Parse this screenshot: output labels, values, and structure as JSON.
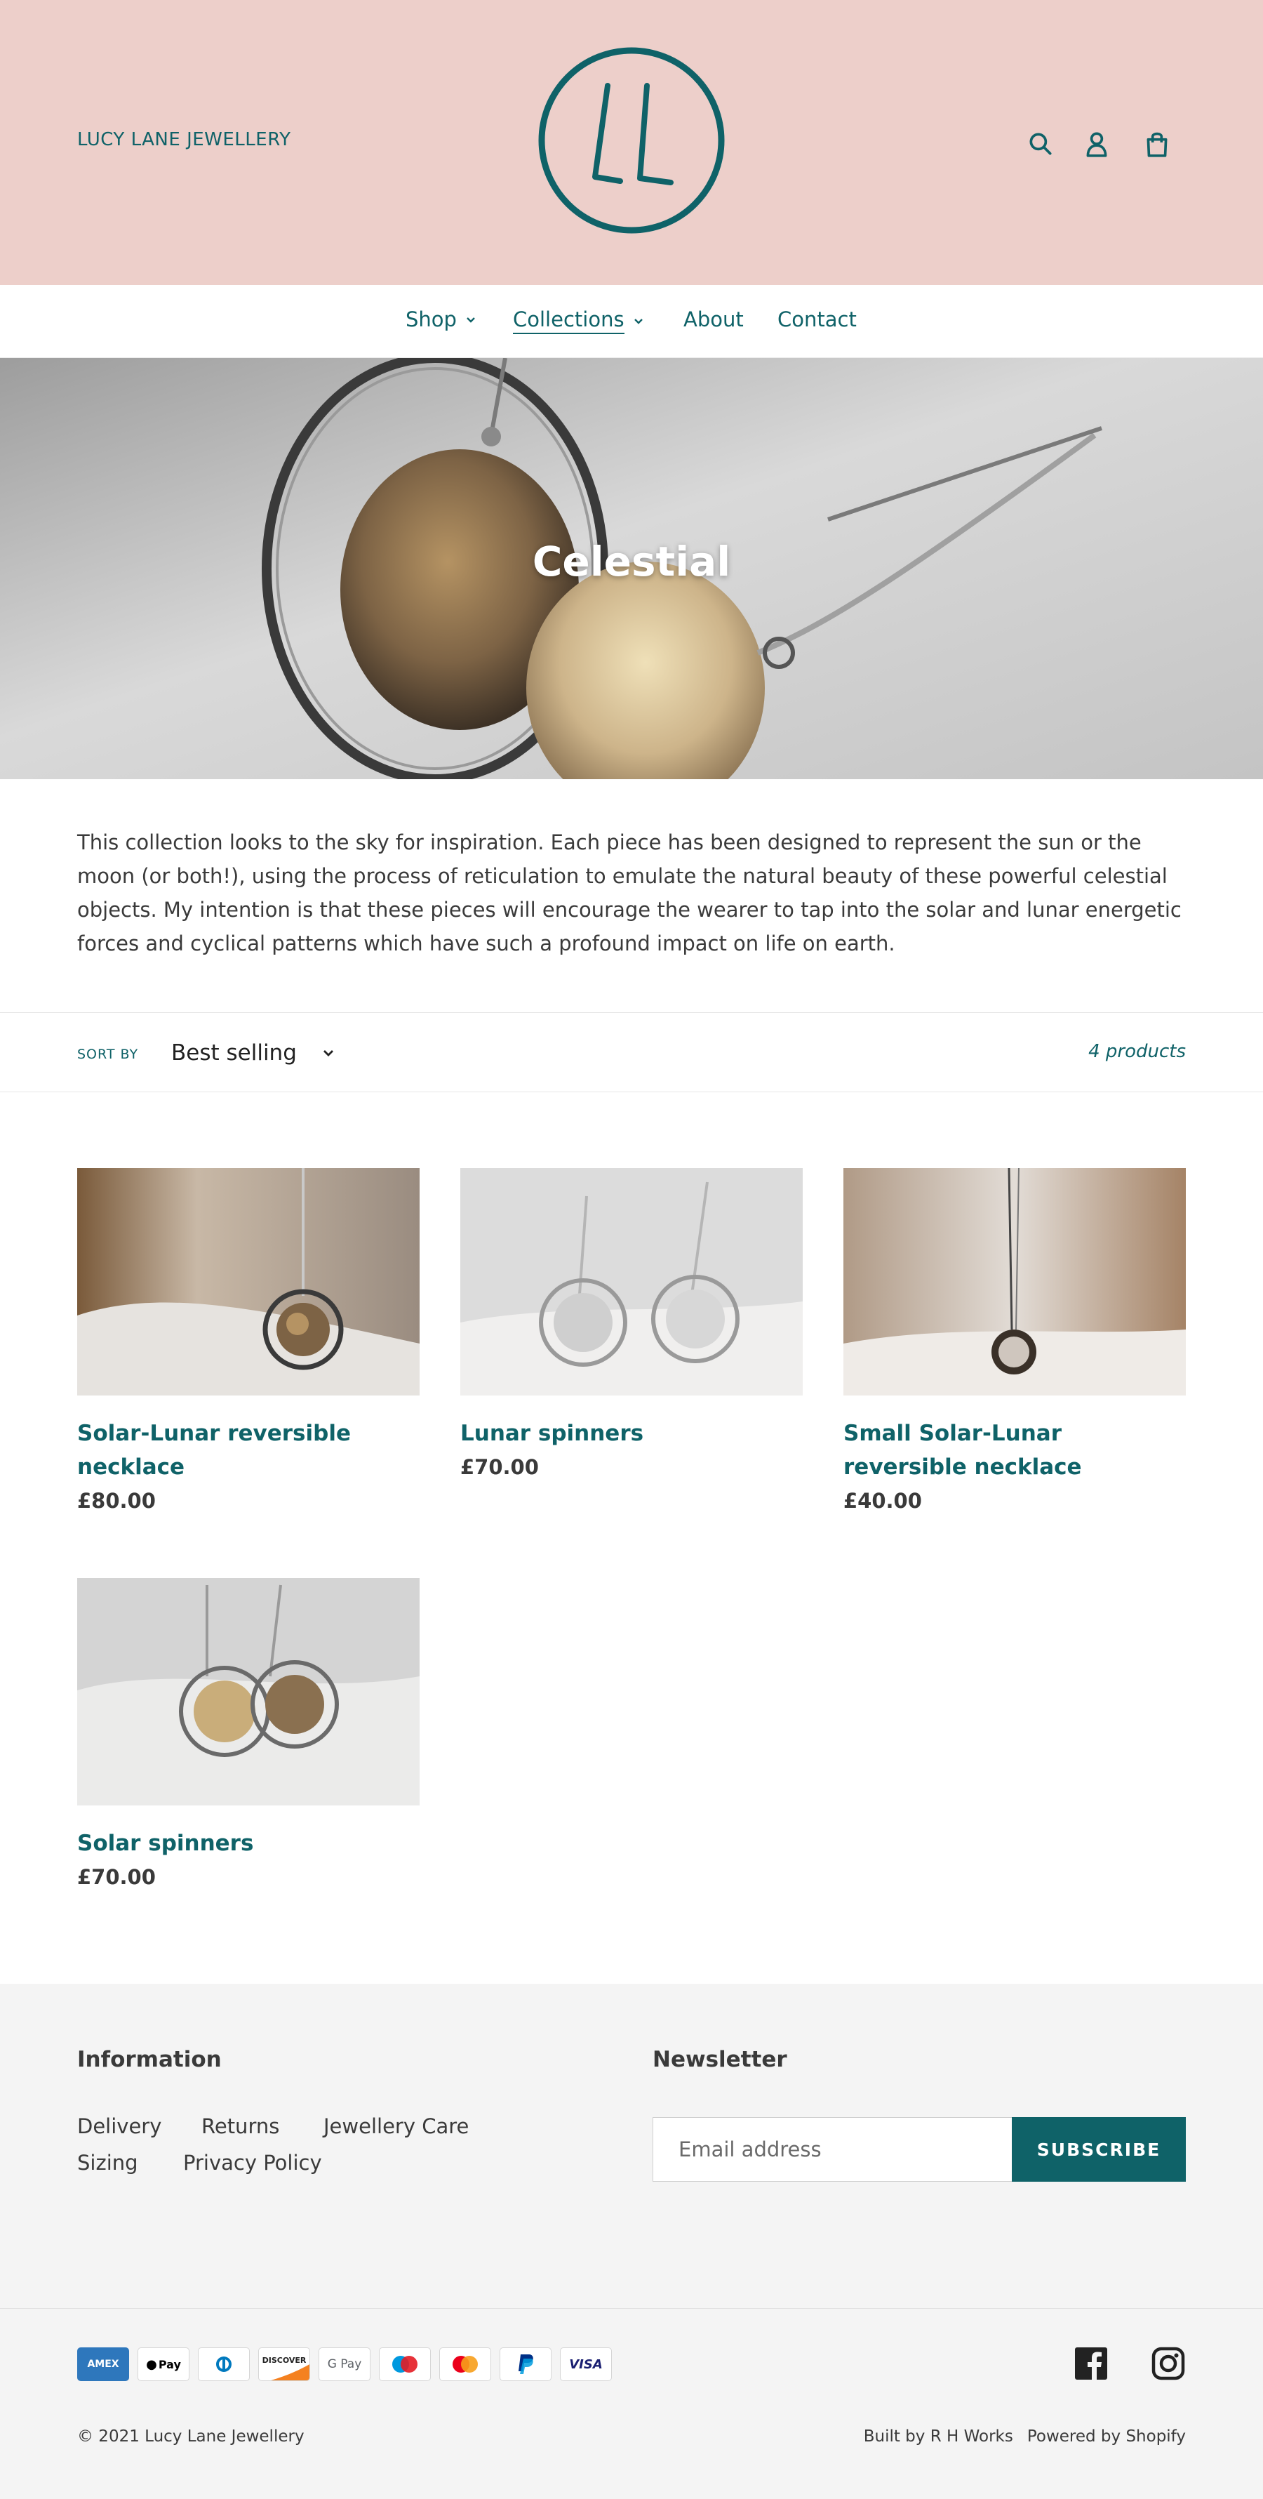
{
  "header": {
    "brand_name": "LUCY LANE JEWELLERY",
    "logo_text": "LL",
    "colors": {
      "header_bg": "#edcfca",
      "accent": "#0f6268"
    },
    "icons": [
      "search-icon",
      "account-icon",
      "cart-icon"
    ]
  },
  "nav": {
    "items": [
      {
        "label": "Shop",
        "has_dropdown": true
      },
      {
        "label": "Collections",
        "has_dropdown": true,
        "active": true
      },
      {
        "label": "About",
        "has_dropdown": false
      },
      {
        "label": "Contact",
        "has_dropdown": false
      }
    ]
  },
  "hero": {
    "title": "Celestial"
  },
  "collection": {
    "description": "This collection looks to the sky for inspiration. Each piece has been designed to represent the sun or the moon (or both!), using the process of reticulation to emulate the natural beauty of these powerful celestial objects. My intention is that these pieces will encourage the wearer to tap into the solar and lunar energetic forces and cyclical patterns which have such a profound impact on life on earth."
  },
  "sort": {
    "label": "SORT BY",
    "selected": "Best selling",
    "count": "4 products"
  },
  "products": [
    {
      "title": "Solar-Lunar reversible necklace",
      "price": "£80.00"
    },
    {
      "title": "Lunar spinners",
      "price": "£70.00"
    },
    {
      "title": "Small Solar-Lunar reversible necklace",
      "price": "£40.00"
    },
    {
      "title": "Solar spinners",
      "price": "£70.00"
    }
  ],
  "footer": {
    "info_heading": "Information",
    "info_links": [
      "Delivery",
      "Returns",
      "Jewellery Care",
      "Sizing",
      "Privacy Policy"
    ],
    "newsletter_heading": "Newsletter",
    "email_placeholder": "Email address",
    "subscribe_label": "SUBSCRIBE",
    "payment_methods": [
      "AMEX",
      "Pay",
      "Diners",
      "DISCOVER",
      "G Pay",
      "Maestro",
      "Mastercard",
      "PayPal",
      "VISA"
    ],
    "social": [
      "facebook-icon",
      "instagram-icon"
    ],
    "copyright": "© 2021 Lucy Lane Jewellery",
    "built_by": "Built by R H Works",
    "powered_by": "Powered by Shopify"
  }
}
